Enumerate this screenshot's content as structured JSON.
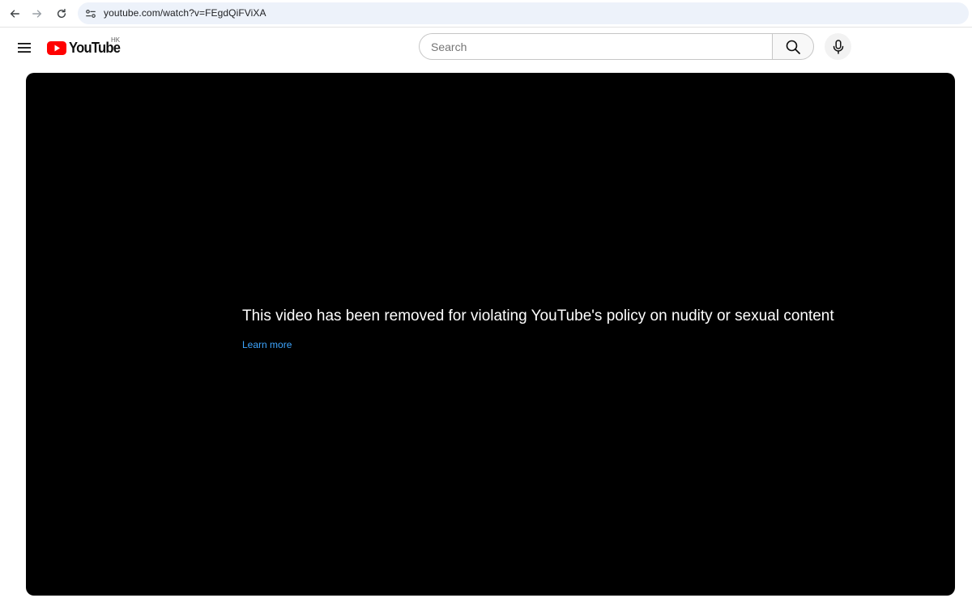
{
  "browser": {
    "url": "youtube.com/watch?v=FEgdQiFViXA",
    "icons": {
      "back": "arrow-left-icon",
      "forward": "arrow-right-icon",
      "reload": "reload-icon",
      "site_info": "tune-icon"
    }
  },
  "masthead": {
    "logo_text": "YouTube",
    "country_code": "HK",
    "search": {
      "placeholder": "Search",
      "value": ""
    },
    "icons": {
      "menu": "hamburger-menu-icon",
      "search": "search-icon",
      "mic": "microphone-icon"
    }
  },
  "player": {
    "error_message": "This video has been removed for violating YouTube's policy on nudity or sexual content",
    "learn_more": "Learn more"
  },
  "colors": {
    "brand_red": "#ff0000",
    "link_blue": "#3ea6ff",
    "player_bg": "#000000",
    "address_bg": "#edf2fa"
  }
}
